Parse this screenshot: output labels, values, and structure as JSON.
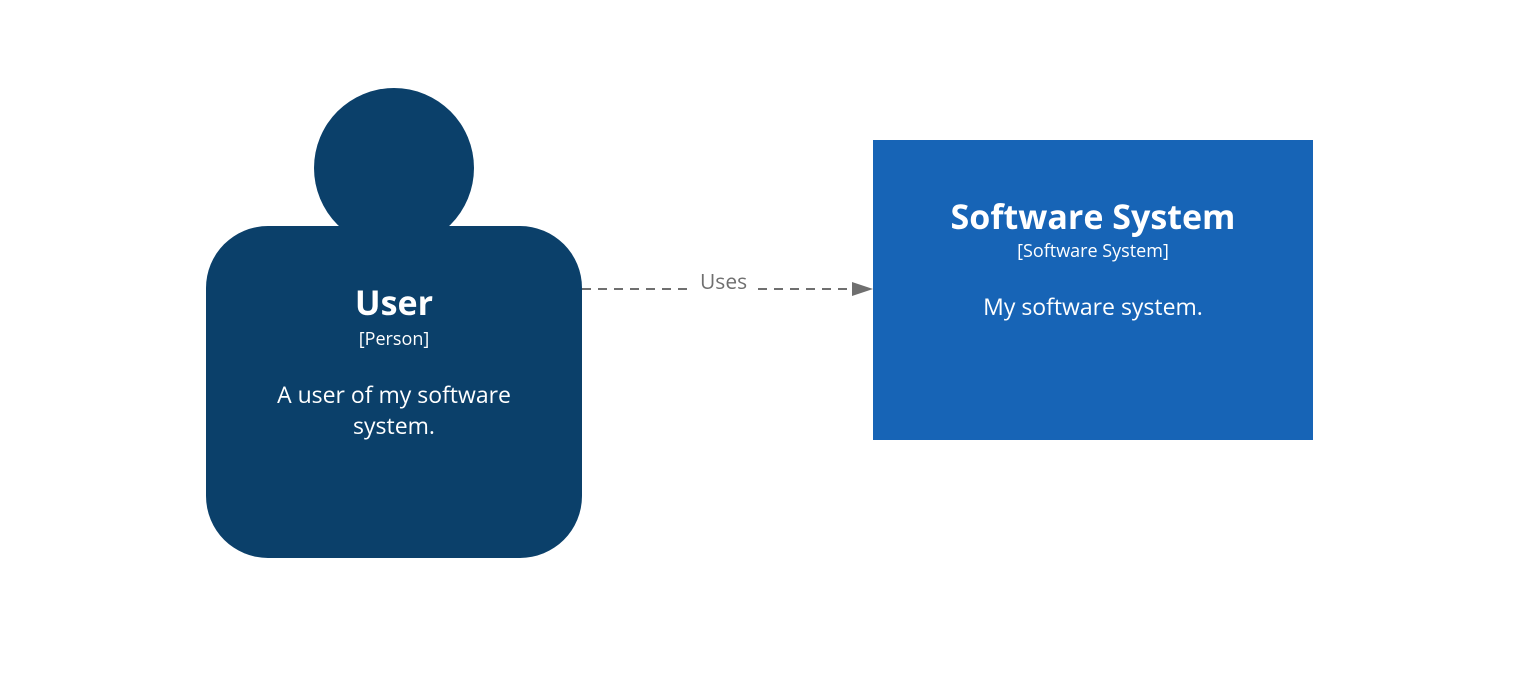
{
  "diagram": {
    "type": "c4-system-context",
    "nodes": {
      "user": {
        "title": "User",
        "stereotype": "[Person]",
        "description": "A user of my software system.",
        "color": "#0b406a"
      },
      "system": {
        "title": "Software System",
        "stereotype": "[Software System]",
        "description": "My software system.",
        "color": "#1764b6"
      }
    },
    "relationships": [
      {
        "from": "user",
        "to": "system",
        "label": "Uses",
        "style": "dashed",
        "color": "#6f6f6f"
      }
    ]
  }
}
